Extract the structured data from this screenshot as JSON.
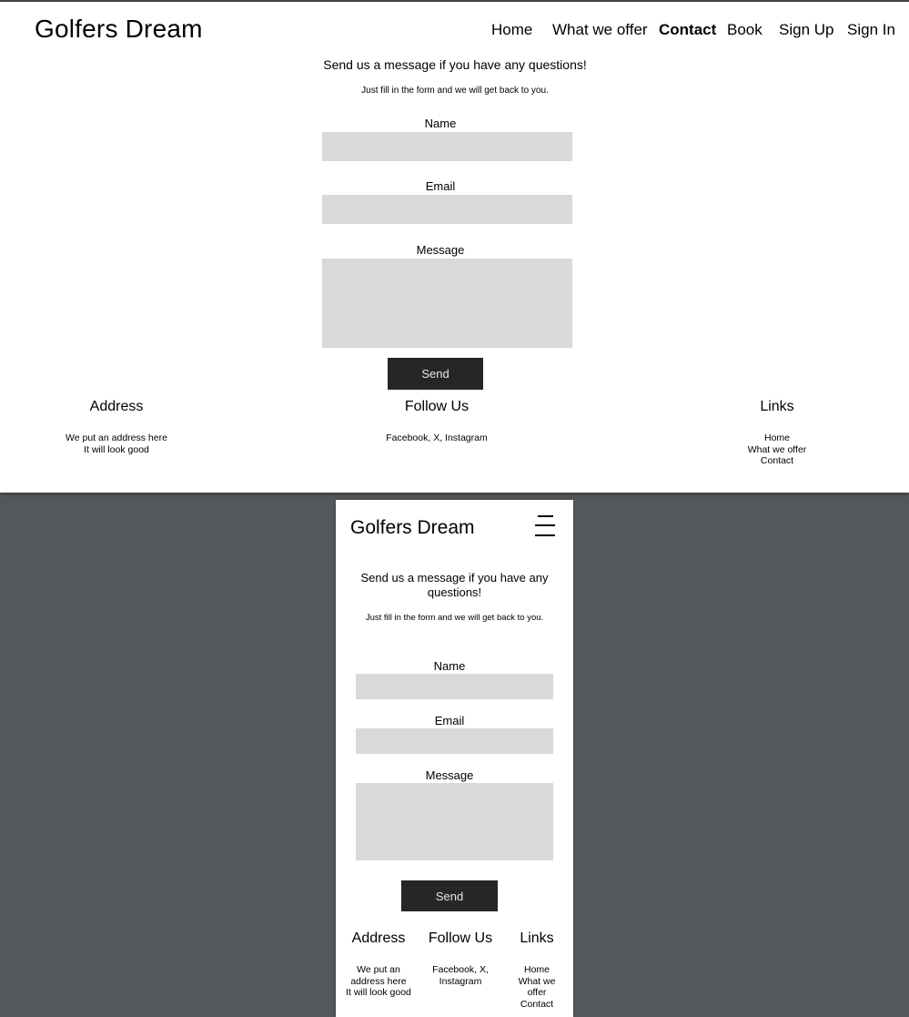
{
  "brand": "Golfers Dream",
  "nav": [
    "Home",
    "What we offer",
    "Contact",
    "Book",
    "Sign Up",
    "Sign In"
  ],
  "active_nav": "Contact",
  "contact": {
    "heading": "Send us a message if you have any questions!",
    "subheading": "Just fill in the form and we will get back to you.",
    "name_label": "Name",
    "email_label": "Email",
    "message_label": "Message",
    "send_label": "Send"
  },
  "footer": {
    "address_title": "Address",
    "address_line1": "We put an address here",
    "address_line2": "It will look good",
    "follow_title": "Follow Us",
    "follow_text": "Facebook, X, Instagram",
    "links_title": "Links",
    "links": [
      "Home",
      "What we offer",
      "Contact"
    ]
  },
  "mobile": {
    "address_lines": [
      "We put an",
      "address here",
      "It will look good"
    ],
    "follow_lines": [
      "Facebook, X,",
      "Instagram"
    ],
    "links_lines": [
      "Home",
      "What we",
      "offer",
      "Contact"
    ],
    "menu_icon": "hamburger-menu-icon"
  },
  "colors": {
    "backdrop": "#55585b",
    "field": "#d9d9d9",
    "button": "#262626"
  }
}
